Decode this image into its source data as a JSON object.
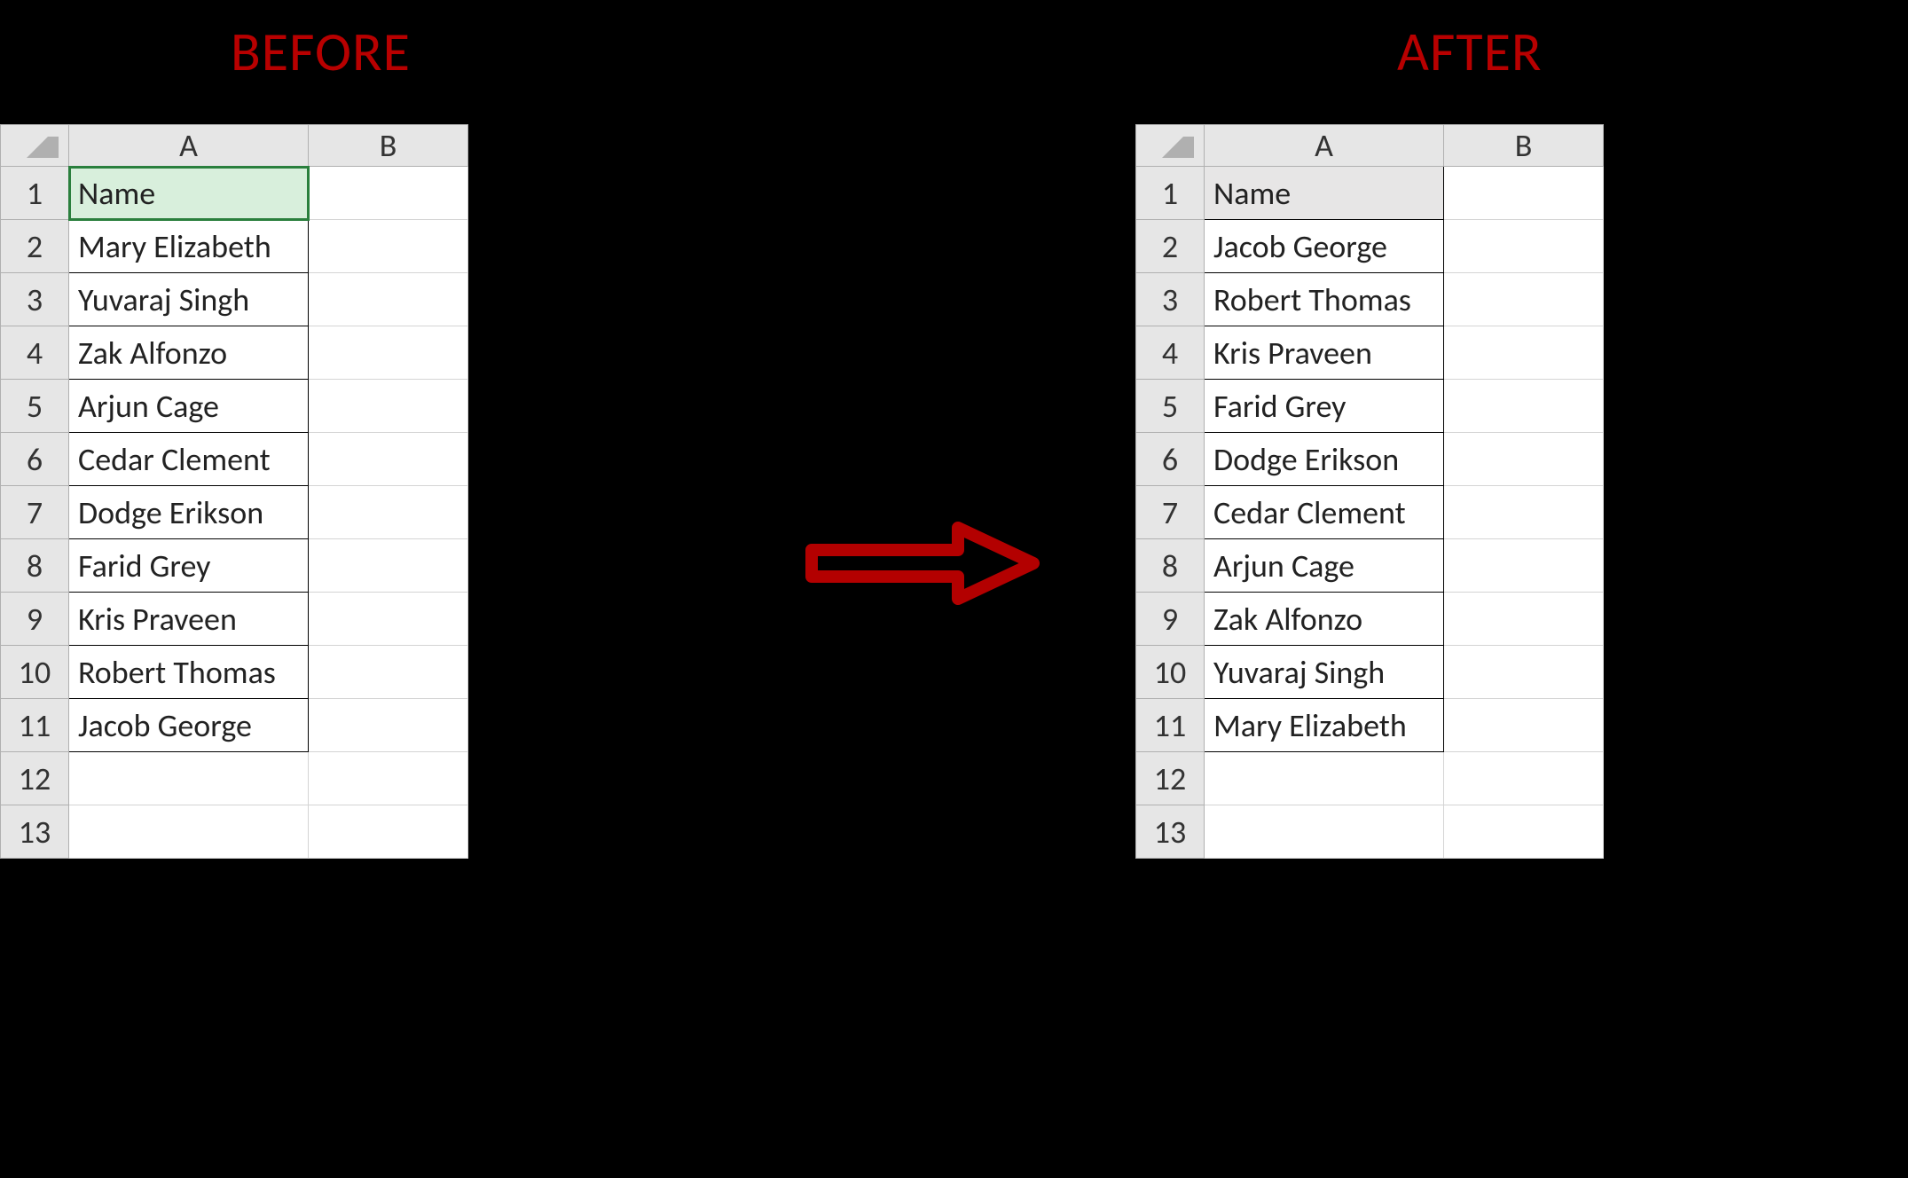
{
  "titles": {
    "before": "BEFORE",
    "after": "AFTER"
  },
  "columns": {
    "A": "A",
    "B": "B"
  },
  "rowNumbers": [
    "1",
    "2",
    "3",
    "4",
    "5",
    "6",
    "7",
    "8",
    "9",
    "10",
    "11",
    "12",
    "13"
  ],
  "before": {
    "header": "Name",
    "rows": [
      "Mary Elizabeth",
      "Yuvaraj Singh",
      "Zak Alfonzo",
      "Arjun Cage",
      "Cedar Clement",
      "Dodge Erikson",
      "Farid Grey",
      "Kris Praveen",
      "Robert Thomas",
      "Jacob George"
    ],
    "activeCell": "A1"
  },
  "after": {
    "header": "Name",
    "rows": [
      "Jacob George",
      "Robert Thomas",
      "Kris Praveen",
      "Farid Grey",
      "Dodge Erikson",
      "Cedar Clement",
      "Arjun Cage",
      "Zak Alfonzo",
      "Yuvaraj Singh",
      "Mary Elizabeth"
    ]
  },
  "colors": {
    "titleRed": "#b80000",
    "arrowRed": "#b30000",
    "activeGreen": "#2a7f3d"
  }
}
